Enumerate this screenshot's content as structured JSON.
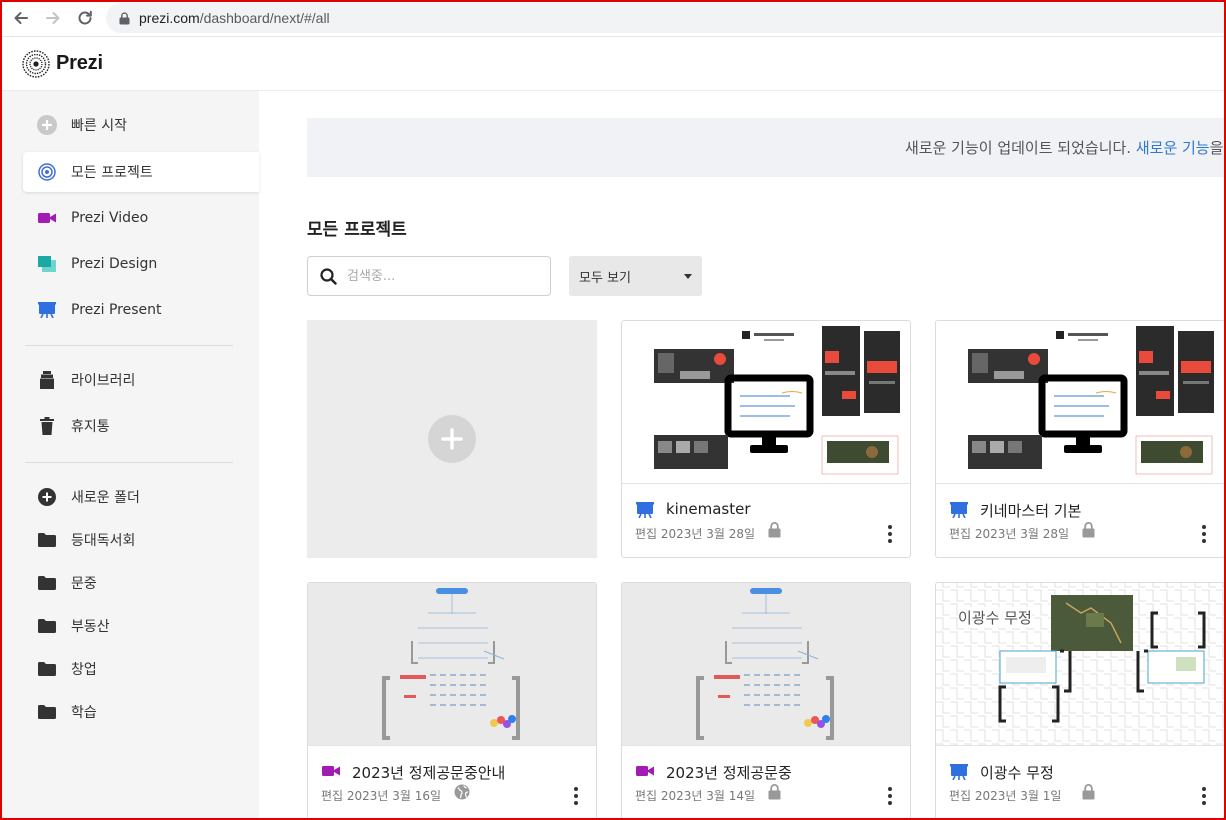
{
  "browser": {
    "url_domain": "prezi.com",
    "url_path": "/dashboard/next/#/all"
  },
  "header": {
    "logo_text": "Prezi"
  },
  "sidebar": {
    "items": [
      {
        "label": "빠른 시작",
        "icon": "plus-circle-icon"
      },
      {
        "label": "모든 프로젝트",
        "icon": "prezi-spiral-icon",
        "active": true
      },
      {
        "label": "Prezi Video",
        "icon": "video-camera-icon"
      },
      {
        "label": "Prezi Design",
        "icon": "design-icon"
      },
      {
        "label": "Prezi Present",
        "icon": "present-icon"
      }
    ],
    "library": [
      {
        "label": "라이브러리",
        "icon": "library-icon"
      },
      {
        "label": "휴지통",
        "icon": "trash-icon"
      }
    ],
    "new_folder": "새로운 폴더",
    "folders": [
      "등대독서회",
      "문중",
      "부동산",
      "창업",
      "학습"
    ]
  },
  "banner": {
    "text": "새로운 기능이 업데이트 되었습니다.",
    "link_text": "새로운 기능",
    "suffix": "을 확"
  },
  "main": {
    "title": "모든 프로젝트",
    "search_placeholder": "검색중...",
    "filter_value": "모두 보기"
  },
  "cards": [
    {
      "title": "kinemaster",
      "date": "편집 2023년 3월 28일",
      "type": "present",
      "status": "lock"
    },
    {
      "title": "키네마스터 기본",
      "date": "편집 2023년 3월 28일",
      "type": "present",
      "status": "lock"
    },
    {
      "title": "2023년 정제공문중안내",
      "date": "편집 2023년 3월 16일",
      "type": "video",
      "status": "public"
    },
    {
      "title": "2023년 정제공문중",
      "date": "편집 2023년 3월 14일",
      "type": "video",
      "status": "lock"
    },
    {
      "title": "이광수 무정",
      "date": "편집 2023년 3월 1일",
      "type": "present",
      "status": "lock",
      "thumb_text": "이광수 무정"
    }
  ],
  "colors": {
    "video": "#a21bb3",
    "design": "#1aa9a5",
    "present": "#2f6fe0",
    "link": "#2e78d6"
  }
}
